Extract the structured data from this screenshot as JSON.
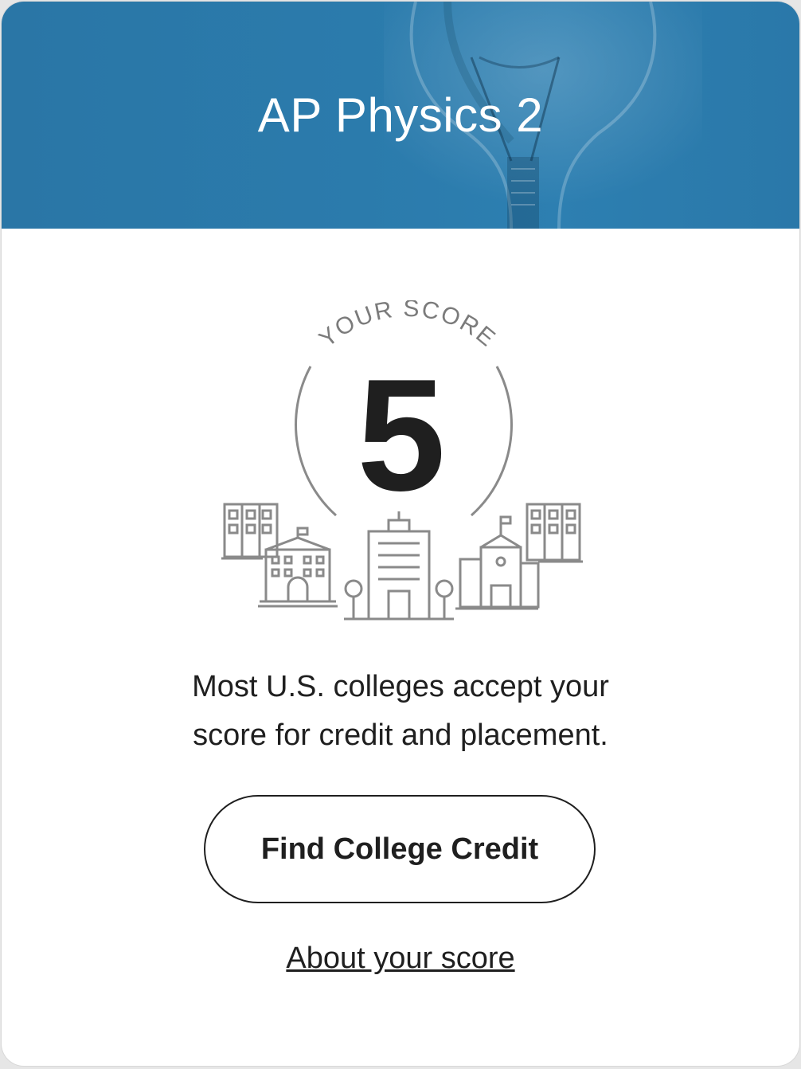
{
  "header": {
    "title": "AP Physics 2",
    "background_color": "#2b7bac",
    "background_image": "light-bulb"
  },
  "score": {
    "label": "YOUR SCORE",
    "value": "5",
    "illustration": "college-buildings-icon"
  },
  "message": {
    "line1": "Most U.S. colleges accept your",
    "line2": "score for credit and placement."
  },
  "actions": {
    "primary_label": "Find College Credit",
    "secondary_link": "About your score"
  }
}
